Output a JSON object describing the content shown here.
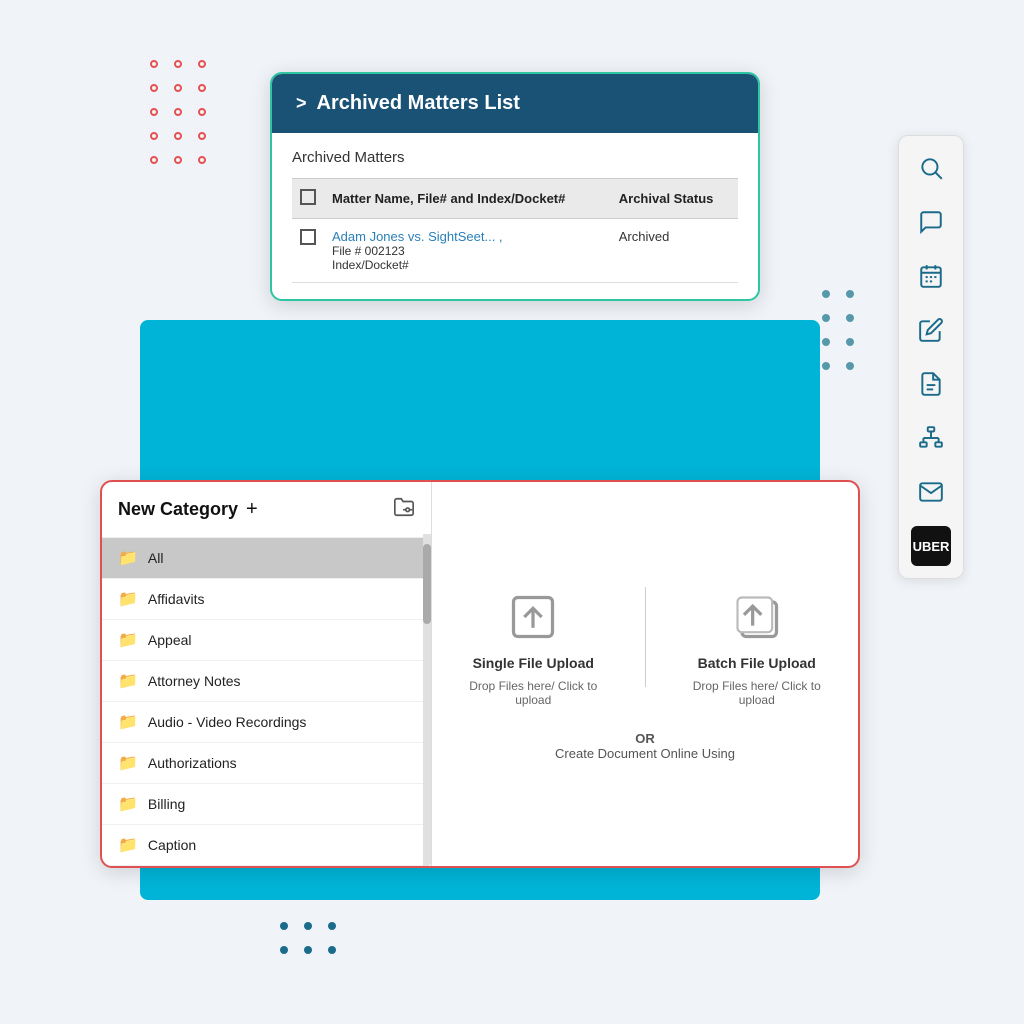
{
  "background": {
    "cyan_color": "#00b4d8"
  },
  "archived_card": {
    "header": {
      "chevron": ">",
      "title": "Archived Matters List"
    },
    "section_title": "Archived Matters",
    "table": {
      "columns": [
        {
          "key": "name",
          "label": "Matter Name, File# and Index/Docket#"
        },
        {
          "key": "status",
          "label": "Archival Status"
        }
      ],
      "rows": [
        {
          "name_link": "Adam Jones vs. SightSeet... ,",
          "name_sub1": "File # 002123",
          "name_sub2": "Index/Docket#",
          "status": "Archived"
        }
      ]
    }
  },
  "sidebar": {
    "icons": [
      {
        "name": "search-icon",
        "label": "Search"
      },
      {
        "name": "chat-icon",
        "label": "Chat"
      },
      {
        "name": "calendar-icon",
        "label": "Calendar"
      },
      {
        "name": "edit-icon",
        "label": "Edit"
      },
      {
        "name": "document-icon",
        "label": "Document"
      },
      {
        "name": "hierarchy-icon",
        "label": "Hierarchy"
      },
      {
        "name": "email-icon",
        "label": "Email"
      },
      {
        "name": "uber-icon",
        "label": "UBER"
      }
    ]
  },
  "category_card": {
    "title": "New Category",
    "plus": "+",
    "items": [
      {
        "label": "All",
        "active": true
      },
      {
        "label": "Affidavits",
        "active": false
      },
      {
        "label": "Appeal",
        "active": false
      },
      {
        "label": "Attorney Notes",
        "active": false
      },
      {
        "label": "Audio - Video Recordings",
        "active": false
      },
      {
        "label": "Authorizations",
        "active": false
      },
      {
        "label": "Billing",
        "active": false
      },
      {
        "label": "Caption",
        "active": false
      }
    ],
    "single_upload": {
      "label": "Single File Upload",
      "sub": "Drop Files here/ Click to upload"
    },
    "batch_upload": {
      "label": "Batch File Upload",
      "sub": "Drop Files here/ Click to upload"
    },
    "or_text": "OR",
    "create_text": "Create Document Online Using"
  }
}
